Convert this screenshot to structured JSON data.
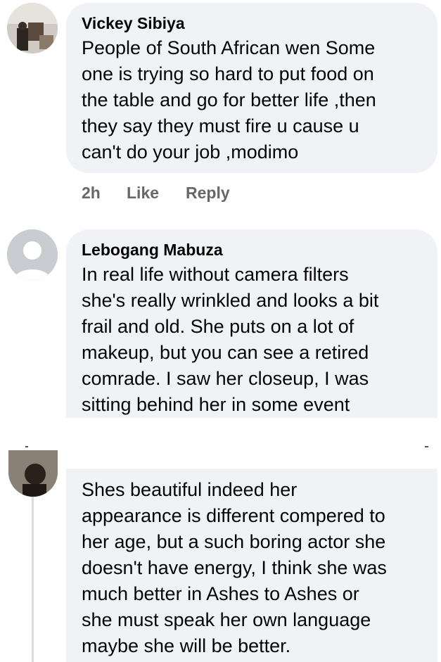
{
  "comments": [
    {
      "author": "Vickey Sibiya",
      "lines": [
        "People of South African wen Some",
        "one is trying so hard to put food on",
        "the table and go for better life ,then",
        "they say they must fire u cause u",
        "can't do your job ,modimo"
      ],
      "time": "2h",
      "like_label": "Like",
      "reply_label": "Reply"
    },
    {
      "author": "Lebogang Mabuza",
      "lines": [
        "In real life without camera filters",
        "she's really wrinkled and looks a bit",
        "frail and old. She puts on a lot of",
        "makeup, but you can see a retired",
        "comrade. I saw her closeup, I was",
        "sitting behind her in some event"
      ]
    },
    {
      "lines": [
        "Shes beautiful indeed her",
        "appearance is different compered to",
        "her age, but a such boring actor she",
        "doesn't have energy, I think she was",
        "much better in Ashes to Ashes or",
        "she must speak her own language",
        "maybe she will be better."
      ]
    }
  ],
  "colors": {
    "bubble": "#f0f2f5",
    "text": "#050505",
    "secondary": "#65676b"
  }
}
